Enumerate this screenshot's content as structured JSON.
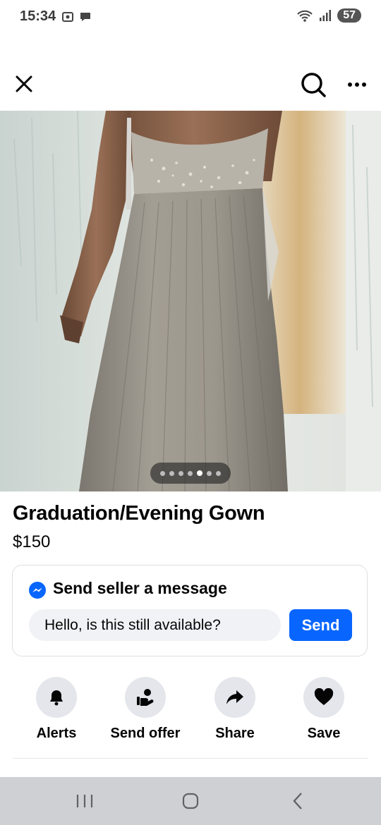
{
  "status": {
    "time": "15:34",
    "battery": "57"
  },
  "listing": {
    "title": "Graduation/Evening Gown",
    "price": "$150",
    "photo_pager": {
      "count": 7,
      "active_index": 4
    }
  },
  "message": {
    "heading": "Send seller a message",
    "input_value": "Hello, is this still available?",
    "send_label": "Send"
  },
  "actions": [
    {
      "label": "Alerts",
      "icon": "bell-icon"
    },
    {
      "label": "Send offer",
      "icon": "hand-offer-icon"
    },
    {
      "label": "Share",
      "icon": "share-arrow-icon"
    },
    {
      "label": "Save",
      "icon": "heart-icon"
    }
  ],
  "colors": {
    "primary": "#0866ff",
    "action_bg": "#e4e6eb",
    "input_bg": "#f0f2f5"
  }
}
